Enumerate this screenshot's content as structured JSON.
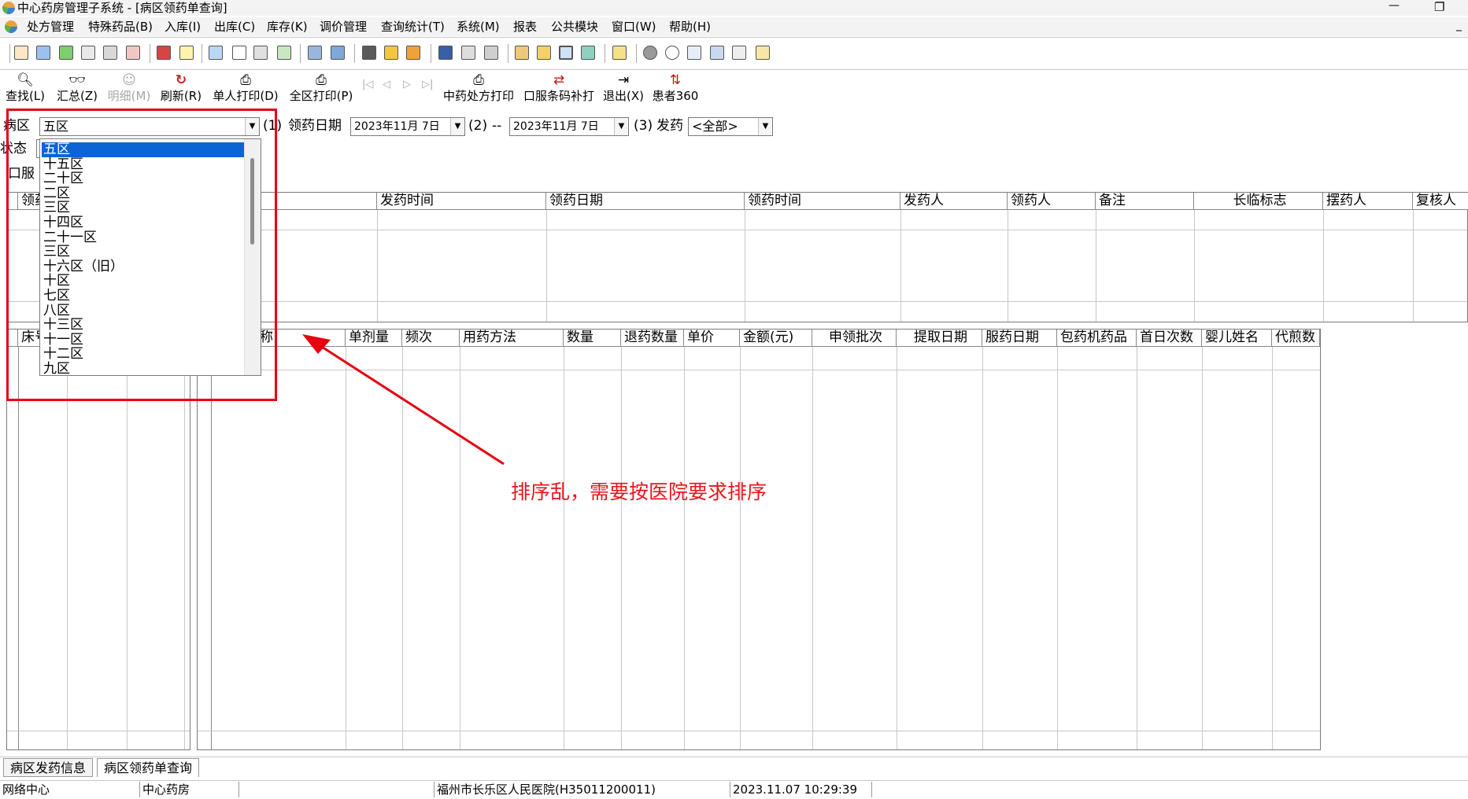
{
  "window": {
    "title": "中心药房管理子系统 - [病区领药单查询]",
    "minimize_glyph": "—",
    "restore_glyph": "❐",
    "inner_minimize_glyph": "_"
  },
  "menu": [
    "处方管理",
    "特殊药品(B)",
    "入库(I)",
    "出库(C)",
    "库存(K)",
    "调价管理",
    "查询统计(T)",
    "系统(M)",
    "报表",
    "公共模块",
    "窗口(W)",
    "帮助(H)"
  ],
  "toolbar2": {
    "find": {
      "label": "查找(L)",
      "icon": "magnifier-icon"
    },
    "summary": {
      "label": "汇总(Z)",
      "icon": "binoculars-icon"
    },
    "detail": {
      "label": "明细(M)",
      "icon": "person-icon"
    },
    "refresh": {
      "label": "刷新(R)",
      "icon": "refresh-icon"
    },
    "single_print": {
      "label": "单人打印(D)",
      "icon": "printer-icon"
    },
    "ward_print": {
      "label": "全区打印(P)",
      "icon": "printer-icon"
    },
    "nav_first": "|◁",
    "nav_prev": "◁",
    "nav_next": "▷",
    "nav_last": "▷|",
    "tcm_print": {
      "label": "中药处方打印",
      "icon": "printer-icon"
    },
    "barcode_reprint": {
      "label": "口服条码补打",
      "icon": "barcode-icon"
    },
    "exit": {
      "label": "退出(X)",
      "icon": "exit-icon"
    },
    "patient360": {
      "label": "患者360",
      "icon": "patient-icon"
    }
  },
  "filters": {
    "ward_label": "病区",
    "ward_value": "五区",
    "mark1": "(1)",
    "date_label": "领药日期",
    "date_from": "2023年11月 7日",
    "mark2": "(2)",
    "dash": "--",
    "date_to": "2023年11月 7日",
    "mark3": "(3)",
    "dispense_label": "发药",
    "dispense_value": "<全部>",
    "status_label": "状态",
    "oral_label": "口服"
  },
  "ward_dropdown": {
    "options": [
      "五区",
      "十五区",
      "二十区",
      "二区",
      "三区",
      "十四区",
      "二十一区",
      "三区",
      "十六区（旧）",
      "十区",
      "七区",
      "八区",
      "十三区",
      "十一区",
      "十二区",
      "九区"
    ],
    "selected_index": 0
  },
  "top_grid": {
    "partial_left_header": "领药",
    "headers": [
      "发药时间",
      "领药日期",
      "领药时间",
      "发药人",
      "领药人",
      "备注",
      "长临标志",
      "摆药人",
      "复核人"
    ]
  },
  "bottom_grid": {
    "left_header": "床号",
    "headers": [
      "称",
      "单剂量",
      "频次",
      "用药方法",
      "数量",
      "退药数量",
      "单价",
      "金额(元)",
      "申领批次",
      "提取日期",
      "服药日期",
      "包药机药品",
      "首日次数",
      "婴儿姓名",
      "代煎数"
    ]
  },
  "annotation": "排序乱，需要按医院要求排序",
  "tabs": [
    "病区发药信息",
    "病区领药单查询"
  ],
  "status": [
    "网络中心",
    "中心药房",
    "",
    "福州市长乐区人民医院(H35011200011)",
    "2023.11.07 10:29:39"
  ],
  "colors": {
    "highlight": "#e60012",
    "annotation": "#e8141c",
    "selection": "#0a64d6"
  }
}
